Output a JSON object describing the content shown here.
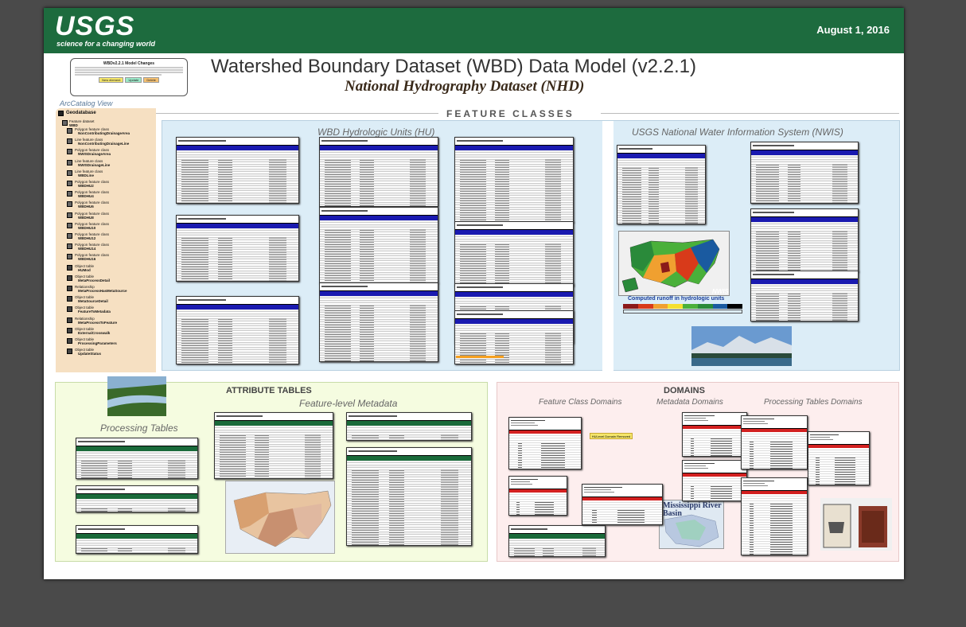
{
  "header": {
    "logo_text": "USGS",
    "logo_tagline": "science for a changing world",
    "date": "August 1, 2016"
  },
  "title": "Watershed Boundary Dataset (WBD) Data Model (v2.2.1)",
  "subtitle": "National Hydrography Dataset (NHD)",
  "changes_box": {
    "heading": "WBDv2.2.1 Model Changes",
    "legend": [
      "New element",
      "Update",
      "Delete"
    ],
    "legend_colors": [
      "#f5e66a",
      "#9be8c8",
      "#f5c070"
    ]
  },
  "arccatalog": {
    "label": "ArcCatalog View",
    "root": "Geodatabase",
    "items": [
      {
        "kind": "Feature dataset",
        "name": "WBD"
      },
      {
        "kind": "Polygon feature class",
        "name": "NonContributingDrainageArea"
      },
      {
        "kind": "Line feature class",
        "name": "NonContributingDrainageLine"
      },
      {
        "kind": "Polygon feature class",
        "name": "NWISDrainageArea"
      },
      {
        "kind": "Line feature class",
        "name": "NWISDrainageLine"
      },
      {
        "kind": "Line feature class",
        "name": "WBDLine"
      },
      {
        "kind": "Polygon feature class",
        "name": "WBDHU2"
      },
      {
        "kind": "Polygon feature class",
        "name": "WBDHU4"
      },
      {
        "kind": "Polygon feature class",
        "name": "WBDHU6"
      },
      {
        "kind": "Polygon feature class",
        "name": "WBDHU8"
      },
      {
        "kind": "Polygon feature class",
        "name": "WBDHU10"
      },
      {
        "kind": "Polygon feature class",
        "name": "WBDHU12"
      },
      {
        "kind": "Polygon feature class",
        "name": "WBDHU14"
      },
      {
        "kind": "Polygon feature class",
        "name": "WBDHU16"
      },
      {
        "kind": "Object table",
        "name": "HUMod"
      },
      {
        "kind": "Object table",
        "name": "MetaProcessDetail"
      },
      {
        "kind": "Relationship",
        "name": "MetaProcessHasMetaSource"
      },
      {
        "kind": "Object table",
        "name": "MetaSourceDetail"
      },
      {
        "kind": "Object table",
        "name": "FeatureToMetadata"
      },
      {
        "kind": "Relationship",
        "name": "MetaProcessToFeature"
      },
      {
        "kind": "Object table",
        "name": "ExternalCrosswalk"
      },
      {
        "kind": "Object table",
        "name": "ProcessingParameters"
      },
      {
        "kind": "Object table",
        "name": "UpdateStatus"
      }
    ]
  },
  "sections": {
    "feature_classes": "FEATURE CLASSES",
    "wbd_hu": "WBD Hydrologic Units (HU)",
    "nwis": "USGS National Water Information System (NWIS)",
    "attribute_tables": "ATTRIBUTE TABLES",
    "feature_level_metadata": "Feature-level Metadata",
    "processing_tables": "Processing Tables",
    "domains": "DOMAINS",
    "feature_class_domains": "Feature Class Domains",
    "metadata_domains": "Metadata Domains",
    "processing_tables_domains": "Processing Tables Domains"
  },
  "nwis_map": {
    "label": "NWIS",
    "runoff_title": "Computed runoff in hydrologic units",
    "legend_colors": [
      "#8b1a1a",
      "#d83a1a",
      "#f0a030",
      "#f5e030",
      "#4ab03a",
      "#2a8a3a",
      "#1a5aa0",
      "#000000"
    ]
  },
  "domain_note": "HULevel Domain Removed",
  "mississippi_label": "Mississippi River Basin",
  "colors": {
    "banner": "#1d6b3e",
    "table_header_blue": "#1a1ab0",
    "table_header_green": "#1a6a3a",
    "domain_red": "#d32020"
  }
}
